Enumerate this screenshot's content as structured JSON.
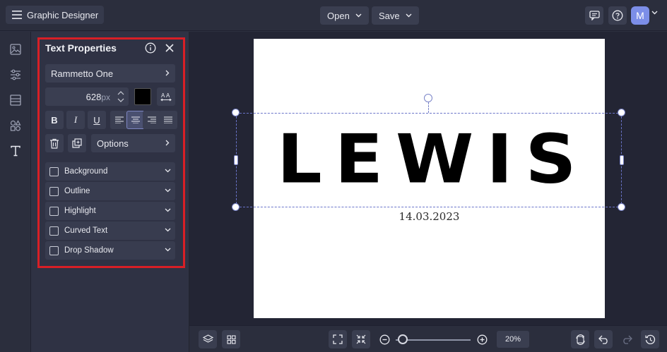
{
  "header": {
    "app_title": "Graphic Designer",
    "open_label": "Open",
    "save_label": "Save",
    "avatar_initial": "M"
  },
  "rail": {
    "items": [
      "image-icon",
      "sliders-icon",
      "layout-icon",
      "shapes-icon",
      "text-icon"
    ]
  },
  "panel": {
    "title": "Text Properties",
    "font_name": "Rammetto One",
    "font_size": "628",
    "font_size_unit": "px",
    "color": "#000000",
    "bold": "B",
    "italic": "I",
    "underline": "U",
    "alignment": "center",
    "options_label": "Options",
    "sections": [
      {
        "label": "Background",
        "checked": false
      },
      {
        "label": "Outline",
        "checked": false
      },
      {
        "label": "Highlight",
        "checked": false
      },
      {
        "label": "Curved Text",
        "checked": false
      },
      {
        "label": "Drop Shadow",
        "checked": false
      }
    ]
  },
  "canvas": {
    "main_text": "LEWIS",
    "date_text": "14.03.2023"
  },
  "bottom": {
    "zoom_value": "20%",
    "zoom_level": 0.03
  },
  "colors": {
    "accent": "#7c8ee8",
    "highlight_border": "#d81f26",
    "panel_bg": "#2f3244",
    "canvas_bg": "#232534"
  }
}
